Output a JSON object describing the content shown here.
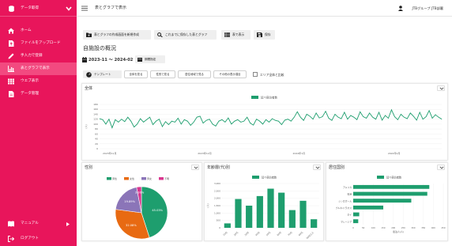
{
  "sidebar": {
    "header": {
      "label": "データ取得"
    },
    "items": [
      {
        "label": "ホーム",
        "icon": "home-icon"
      },
      {
        "label": "ファイルをアップロード",
        "icon": "file-upload-icon"
      },
      {
        "label": "手入力で登録",
        "icon": "pencil-icon"
      },
      {
        "label": "表とグラフで表示",
        "icon": "chart-icon",
        "active": true
      },
      {
        "label": "ウエブ表示",
        "icon": "grid-icon"
      },
      {
        "label": "データ管理",
        "icon": "file-icon"
      }
    ],
    "manual": {
      "label": "マニュアル"
    },
    "logout": {
      "label": "ログアウト"
    }
  },
  "topbar": {
    "title": "表とグラフで表示",
    "user": "JTBグループ JTB部署"
  },
  "toolbar": {
    "new_label": "表とグラフの作成画面を新規作成",
    "open_label": "これまでに保存した表とグラフ",
    "table_label": "表で表示",
    "save_label": "保存"
  },
  "page": {
    "heading": "自施設の概況",
    "period": "2023-11 〜 2024-02",
    "period_button": "期間指定"
  },
  "filters": {
    "template": "テンプレート",
    "pills": [
      "全体を見る",
      "性別で見る",
      "居住地域で見る",
      "その他の表示項目"
    ],
    "compare_label": "エリア全体と比較"
  },
  "colors": {
    "accent": "#e8155b",
    "series": "#1e9e6e",
    "pie": [
      "#1e9e6e",
      "#e86a12",
      "#8b75b8",
      "#d9368f"
    ]
  },
  "line_card": {
    "title": "全体",
    "chart_data": {
      "type": "line",
      "legend": "延べ宿泊者数",
      "ylim": [
        0,
        180
      ],
      "yticks": [
        0,
        20,
        40,
        60,
        80,
        100,
        120,
        140,
        160,
        180
      ],
      "ylabel": "(人)",
      "xlabels": [
        "2023年11月",
        "2023年12月",
        "2024年1月",
        "2024年2月"
      ],
      "values": [
        122,
        118,
        100,
        120,
        85,
        118,
        108,
        120,
        110,
        128,
        112,
        88,
        100,
        122,
        108,
        118,
        128,
        98,
        112,
        120,
        90,
        110,
        98,
        112,
        108,
        124,
        100,
        118,
        112,
        95,
        108,
        128,
        132,
        104,
        115,
        120,
        100,
        92,
        112,
        118,
        108,
        125,
        100,
        112,
        118,
        108,
        112,
        128,
        104,
        96,
        120,
        112,
        100,
        118,
        108,
        122,
        115,
        112,
        98,
        116,
        120,
        112,
        128,
        150,
        128,
        115,
        140,
        132,
        120,
        145,
        125,
        130,
        152,
        124,
        115,
        140,
        128,
        122,
        148,
        120,
        135,
        128,
        118,
        150,
        130,
        124,
        145,
        128,
        120,
        148,
        116,
        135,
        124,
        158,
        130,
        118,
        140,
        128,
        122,
        145,
        132,
        116,
        148,
        120,
        130,
        155,
        124,
        138,
        128,
        120
      ]
    }
  },
  "gender_card": {
    "title": "性別",
    "chart_data": {
      "type": "pie",
      "legend": [
        "男性",
        "女性",
        "男女",
        "不明"
      ],
      "slices": [
        {
          "name": "男性",
          "value": 45.03,
          "label": "45.03%"
        },
        {
          "name": "女性",
          "value": 32.08,
          "label": "32.08%"
        },
        {
          "name": "男女",
          "value": 19.89,
          "label": "19.89%"
        },
        {
          "name": "不明",
          "value": 3.0,
          "label": "3.00%"
        }
      ]
    }
  },
  "age_card": {
    "title": "年齢層(代)別",
    "chart_data": {
      "type": "bar",
      "legend": "延べ宿泊者数",
      "categories": [
        "10代",
        "20代",
        "30代",
        "40代",
        "50代",
        "60代",
        "70代",
        "80代",
        "90代以上"
      ],
      "values": [
        300,
        1950,
        1500,
        2150,
        2650,
        2380,
        1200,
        1830,
        580
      ],
      "ylim": [
        0,
        3000
      ],
      "yticks": [
        0,
        500,
        1000,
        1500,
        2000,
        2500,
        3000
      ],
      "ylabel": "(人)"
    }
  },
  "region_card": {
    "title": "居住国別",
    "chart_data": {
      "type": "bar",
      "legend": "延べ宿泊者数",
      "categories": [
        "アメリカ",
        "香港",
        "シンガポール",
        "ブルネイ/ラオス",
        "タイ",
        "マレーシア"
      ],
      "values": [
        380,
        370,
        290,
        150,
        30,
        25
      ],
      "xlim": [
        0,
        450
      ],
      "xticks": [
        0,
        50,
        100,
        150,
        200,
        250,
        300,
        350,
        400,
        450
      ],
      "xlabel": "宿泊人(人)"
    }
  }
}
